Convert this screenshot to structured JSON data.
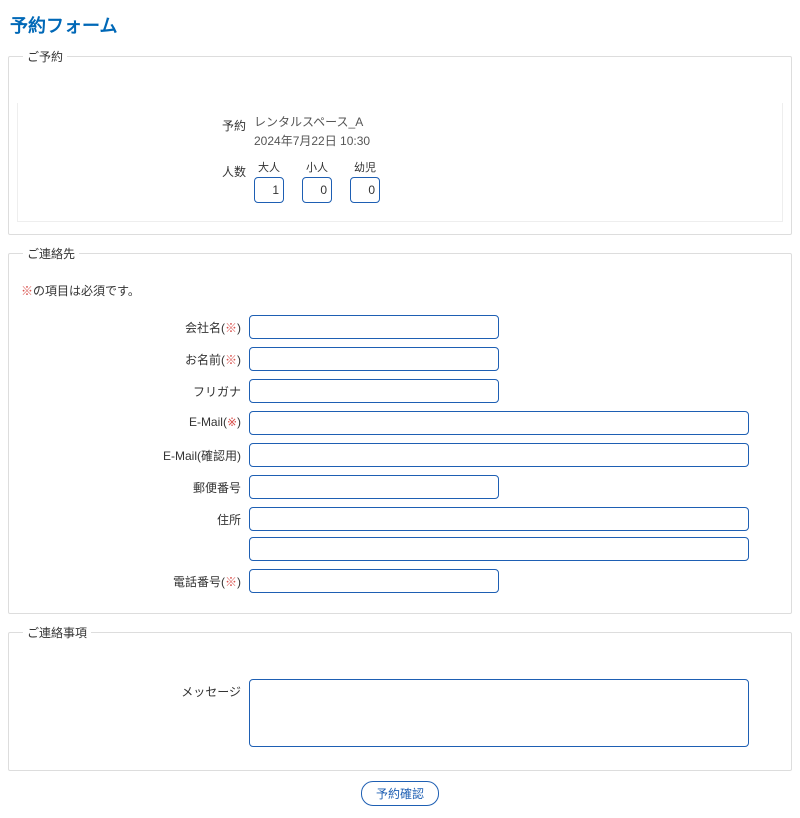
{
  "page_title": "予約フォーム",
  "reservation": {
    "legend": "ご予約",
    "label_reserve": "予約",
    "resource_name": "レンタルスペース_A",
    "datetime": "2024年7月22日 10:30",
    "label_people": "人数",
    "people": {
      "adult_label": "大人",
      "adult_value": "1",
      "child_label": "小人",
      "child_value": "0",
      "infant_label": "幼児",
      "infant_value": "0"
    }
  },
  "contact": {
    "legend": "ご連絡先",
    "required_note_prefix": "※",
    "required_note_suffix": "の項目は必須です。",
    "company_label": "会社名(",
    "company_req": "※",
    "company_close": ")",
    "name_label": "お名前(",
    "name_req": "※",
    "name_close": ")",
    "furigana_label": "フリガナ",
    "email_label": "E-Mail(",
    "email_req": "※",
    "email_close": ")",
    "email_confirm_label": "E-Mail(確認用)",
    "postal_label": "郵便番号",
    "address_label": "住所",
    "phone_label": "電話番号(",
    "phone_req": "※",
    "phone_close": ")"
  },
  "message_section": {
    "legend": "ご連絡事項",
    "message_label": "メッセージ"
  },
  "submit_label": "予約確認"
}
